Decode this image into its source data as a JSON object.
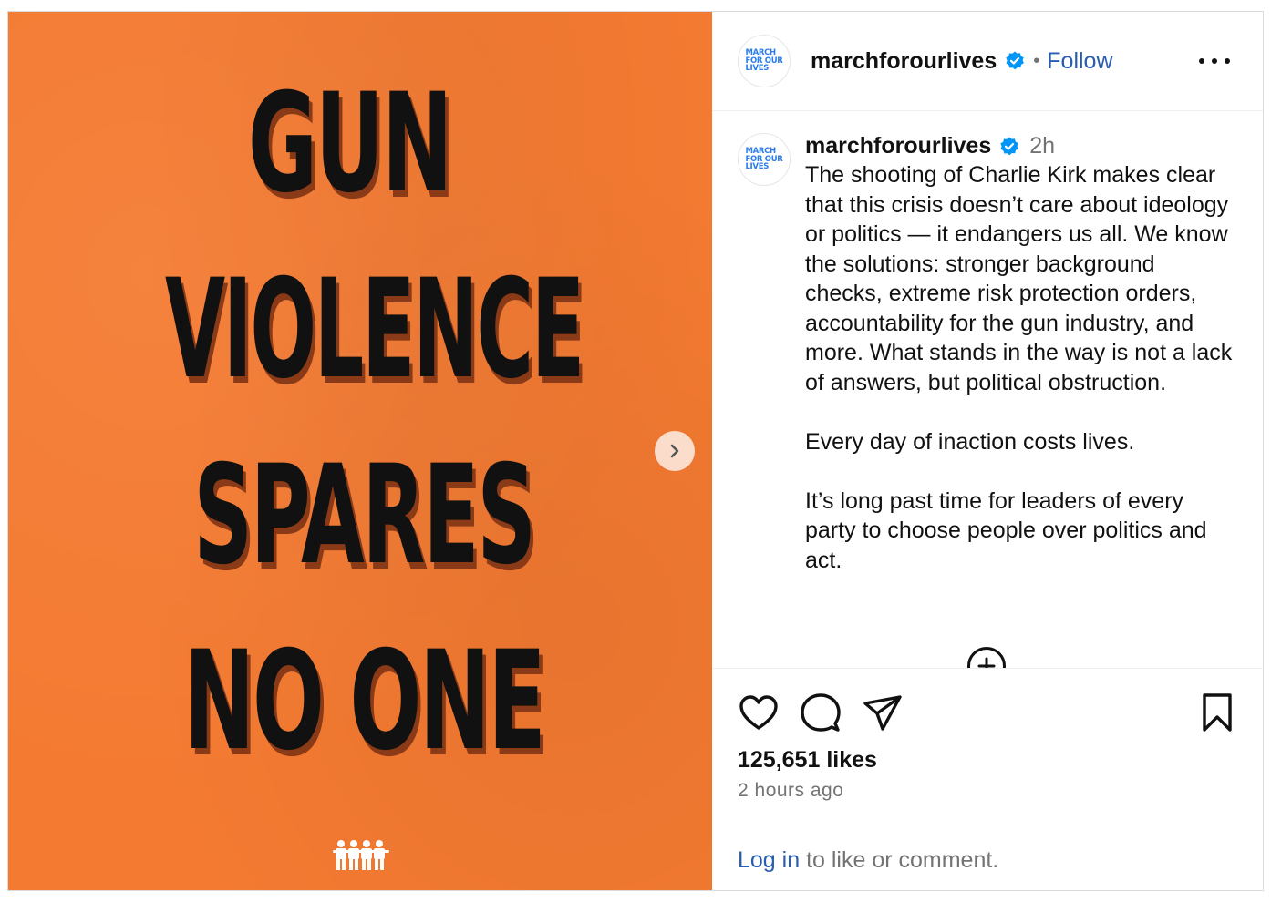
{
  "media": {
    "headline_lines": [
      "GUN",
      "VIOLENCE",
      "SPARES",
      "NO ONE"
    ],
    "background_color": "#f47a31",
    "next_icon": "chevron-right-icon",
    "logo_icon": "people-group-icon"
  },
  "header": {
    "avatar_text": [
      "MARCH",
      "FOR OUR",
      "LIVES"
    ],
    "username": "marchforourlives",
    "verified_icon": "verified-badge-icon",
    "separator": "•",
    "follow_label": "Follow",
    "more_icon": "more-options-icon"
  },
  "caption": {
    "username": "marchforourlives",
    "time": "2h",
    "text": "The shooting of Charlie Kirk makes clear that this crisis doesn’t care about ideology or politics — it endangers us all. We know the solutions: stronger background checks, extreme risk protection orders, accountability for the gun industry, and more. What stands in the way is not a lack of answers, but political obstruction.\n\nEvery day of inaction costs lives.\n\nIt’s long past time for leaders of every party to choose people over politics and act.",
    "load_more_icon": "plus-circle-icon"
  },
  "actions": {
    "icons": [
      "heart-icon",
      "comment-icon",
      "share-icon",
      "bookmark-icon"
    ],
    "likes": "125,651 likes",
    "time_ago": "2 hours ago",
    "login_link": "Log in",
    "login_suffix": " to like or comment."
  },
  "colors": {
    "accent_link": "#2a5db0",
    "verified_blue": "#0095f6",
    "secondary_text": "#737373"
  }
}
